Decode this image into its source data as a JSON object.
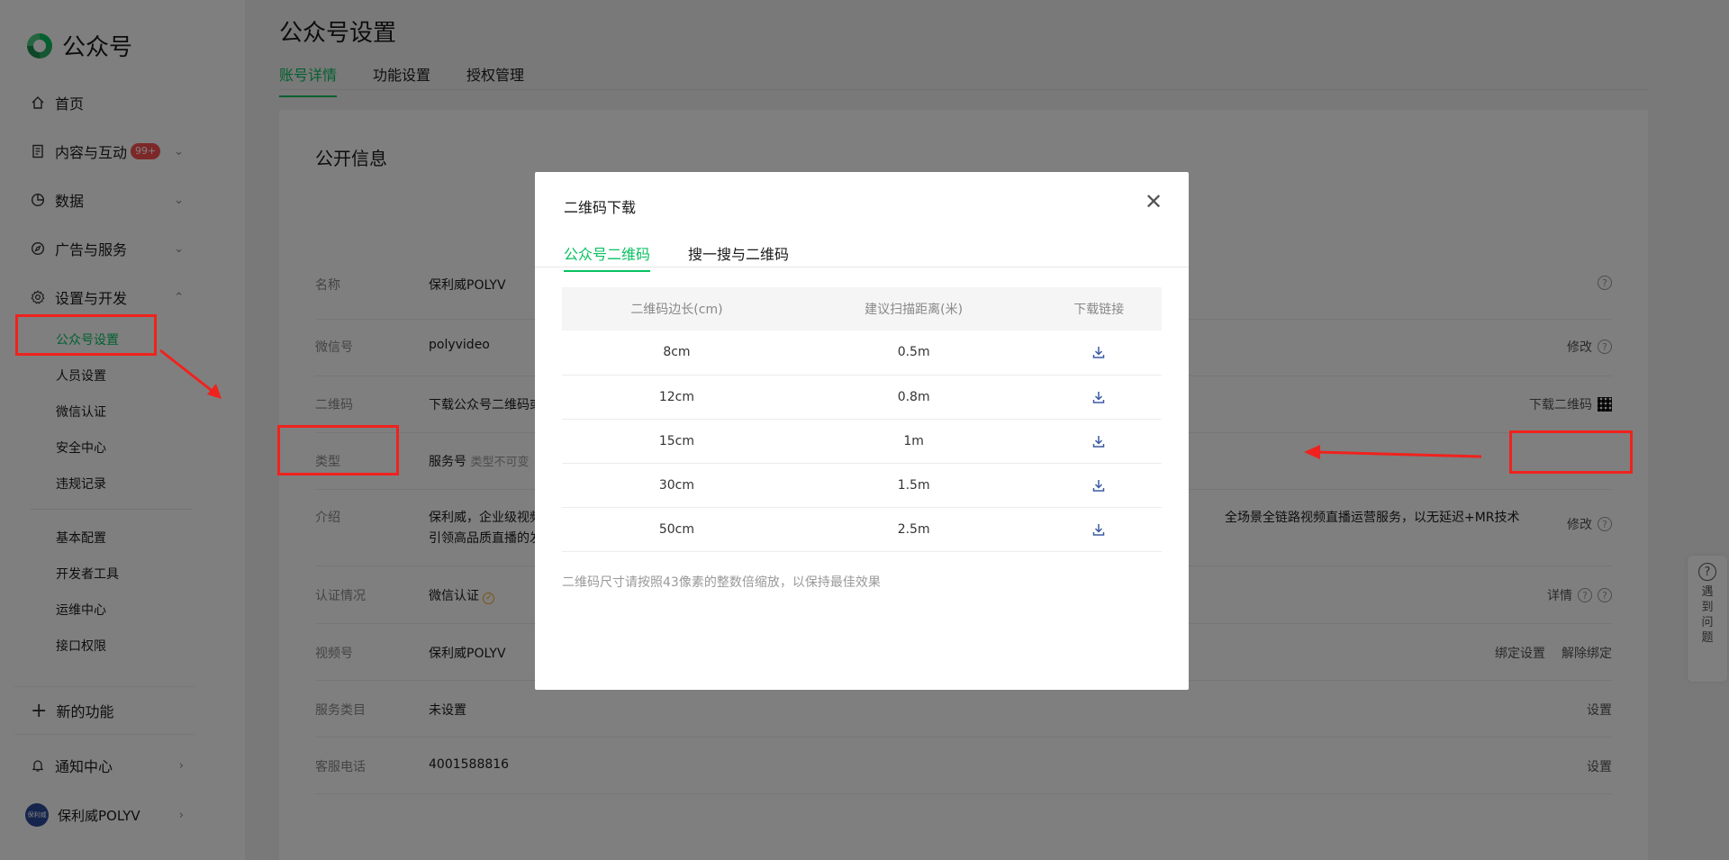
{
  "sidebar": {
    "logo_text": "公众号",
    "nav": [
      {
        "label": "首页",
        "icon": "home-icon"
      },
      {
        "label": "内容与互动",
        "icon": "document-icon",
        "badge": "99+"
      },
      {
        "label": "数据",
        "icon": "pie-chart-icon"
      },
      {
        "label": "广告与服务",
        "icon": "compass-icon"
      },
      {
        "label": "设置与开发",
        "icon": "gear-icon"
      }
    ],
    "sub_items_1": [
      "公众号设置",
      "人员设置",
      "微信认证",
      "安全中心",
      "违规记录"
    ],
    "sub_items_2": [
      "基本配置",
      "开发者工具",
      "运维中心",
      "接口权限"
    ],
    "new_feature": "新的功能",
    "notification": "通知中心",
    "account": "保利威POLYV",
    "account_avatar_text": "保利威"
  },
  "main": {
    "title": "公众号设置",
    "tabs": [
      "账号详情",
      "功能设置",
      "授权管理"
    ],
    "section_title": "公开信息",
    "rows": [
      {
        "label": "名称",
        "value": "保利威POLYV",
        "action": ""
      },
      {
        "label": "微信号",
        "value": "polyvideo",
        "action": "修改"
      },
      {
        "label": "二维码",
        "value": "下载公众号二维码或",
        "action": "下载二维码"
      },
      {
        "label": "类型",
        "value": "服务号",
        "value_muted": "类型不可变",
        "action": ""
      },
      {
        "label": "介绍",
        "value": "保利威，企业级视频",
        "value_right": "全场景全链路视频直播运营服务，以无延迟+MR技术",
        "value_line2": "引领高品质直播的发",
        "action": "修改"
      },
      {
        "label": "认证情况",
        "value": "微信认证",
        "action": "详情"
      },
      {
        "label": "视频号",
        "value": "保利威POLYV",
        "action": "绑定设置",
        "action2": "解除绑定"
      },
      {
        "label": "服务类目",
        "value": "未设置",
        "action": "设置"
      },
      {
        "label": "客服电话",
        "value": "4001588816",
        "action": "设置"
      }
    ]
  },
  "help_float": {
    "chars": [
      "遇",
      "到",
      "问",
      "题"
    ]
  },
  "modal": {
    "title": "二维码下载",
    "tabs": [
      "公众号二维码",
      "搜一搜与二维码"
    ],
    "columns": [
      "二维码边长(cm)",
      "建议扫描距离(米)",
      "下载链接"
    ],
    "rows": [
      {
        "size": "8cm",
        "distance": "0.5m"
      },
      {
        "size": "12cm",
        "distance": "0.8m"
      },
      {
        "size": "15cm",
        "distance": "1m"
      },
      {
        "size": "30cm",
        "distance": "1.5m"
      },
      {
        "size": "50cm",
        "distance": "2.5m"
      }
    ],
    "note": "二维码尺寸请按照43像素的整数倍缩放，以保持最佳效果"
  },
  "colors": {
    "accent": "#07c160",
    "annotation": "#f0221d",
    "badge": "#fa5151"
  }
}
